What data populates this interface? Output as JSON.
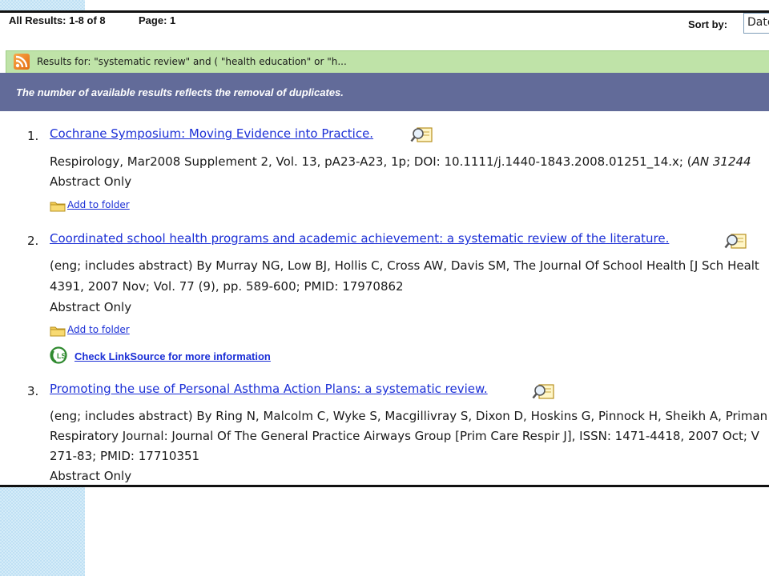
{
  "header": {
    "results_count": "All Results: 1-8 of 8",
    "page": "Page: 1",
    "sort_label": "Sort by:",
    "sort_value": "Date"
  },
  "query_bar": {
    "text": "Results for:   \"systematic review\" and ( \"health education\" or \"h...",
    "icon": "rss-feed-icon"
  },
  "notice": {
    "text": "The number of available results reflects the removal of duplicates."
  },
  "results": [
    {
      "number": "1.",
      "title": "Cochrane Symposium: Moving Evidence into Practice.",
      "lines": [
        "Respirology, Mar2008 Supplement 2, Vol. 13, pA23-A23, 1p; DOI: 10.1111/j.1440-1843.2008.01251_14.x; (",
        "Abstract Only"
      ],
      "an_text": "AN 31244",
      "folder_link": "Add to folder"
    },
    {
      "number": "2.",
      "title": "Coordinated school health programs and academic achievement: a systematic review of the literature.",
      "lines": [
        "(eng; includes abstract) By Murray NG, Low BJ, Hollis C, Cross AW, Davis SM, The Journal Of School Health [J Sch Healt",
        "4391, 2007 Nov; Vol. 77 (9), pp. 589-600; PMID: 17970862",
        "Abstract Only"
      ],
      "folder_link": "Add to folder",
      "linksource": "Check LinkSource for more information"
    },
    {
      "number": "3.",
      "title": "Promoting the use of Personal Asthma Action Plans: a systematic review.",
      "lines": [
        "(eng; includes abstract) By Ring N, Malcolm C, Wyke S, Macgillivray S, Dixon D, Hoskins G, Pinnock H, Sheikh A, Priman",
        "Respiratory Journal: Journal Of The General Practice Airways Group [Prim Care Respir J], ISSN: 1471-4418, 2007 Oct; V",
        "271-83; PMID: 17710351",
        "Abstract Only"
      ]
    }
  ],
  "colors": {
    "link": "#1b2fd6",
    "query_bar": "#bfe3a8",
    "notice_bar": "#626b99",
    "left_pattern": "#d6ecf8"
  }
}
